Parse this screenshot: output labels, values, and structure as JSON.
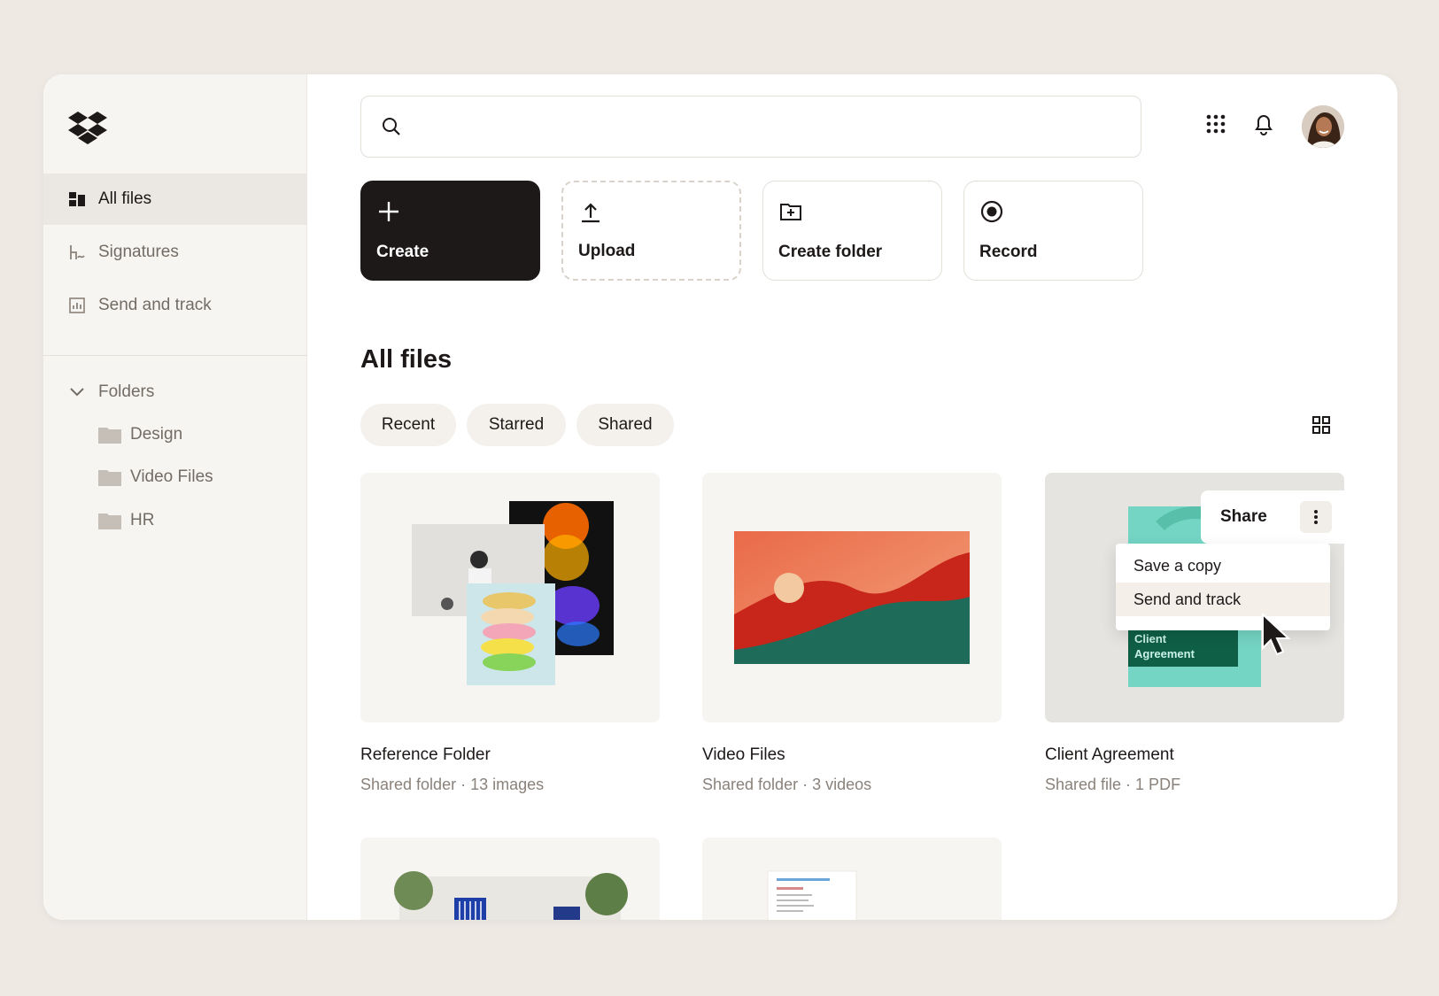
{
  "sidebar": {
    "logo_icon": "dropbox-logo-icon",
    "nav": [
      {
        "label": "All files",
        "icon": "all-files-icon",
        "active": true
      },
      {
        "label": "Signatures",
        "icon": "signature-icon",
        "active": false
      },
      {
        "label": "Send and track",
        "icon": "chart-icon",
        "active": false
      }
    ],
    "folders_label": "Folders",
    "folders": [
      {
        "label": "Design",
        "icon": "folder-icon"
      },
      {
        "label": "Video Files",
        "icon": "folder-icon"
      },
      {
        "label": "HR",
        "icon": "folder-icon"
      }
    ]
  },
  "header": {
    "search_icon": "search-icon",
    "search_placeholder": "",
    "apps_icon": "grid-apps-icon",
    "bell_icon": "bell-icon",
    "avatar_icon": "avatar"
  },
  "actions": [
    {
      "label": "Create",
      "icon": "plus-icon"
    },
    {
      "label": "Upload",
      "icon": "upload-icon"
    },
    {
      "label": "Create folder",
      "icon": "folder-plus-icon"
    },
    {
      "label": "Record",
      "icon": "record-icon"
    }
  ],
  "main": {
    "title": "All files",
    "filters": [
      "Recent",
      "Starred",
      "Shared"
    ],
    "view_toggle_icon": "grid-view-icon",
    "cards": [
      {
        "name": "Reference Folder",
        "meta": "Shared folder · 13 images"
      },
      {
        "name": "Video Files",
        "meta": "Shared folder · 3 videos"
      },
      {
        "name": "Client Agreement",
        "meta": "Shared file · 1 PDF",
        "thumb_text": "Client Agreement"
      }
    ],
    "share": {
      "button": "Share",
      "menu": [
        "Save a copy",
        "Send and track"
      ]
    }
  },
  "colors": {
    "background": "#efe9e4",
    "primary_dark": "#1e1919",
    "sidebar_bg": "#f7f5f2",
    "teal": "#74d5c4",
    "green_dark": "#0f5f46"
  }
}
